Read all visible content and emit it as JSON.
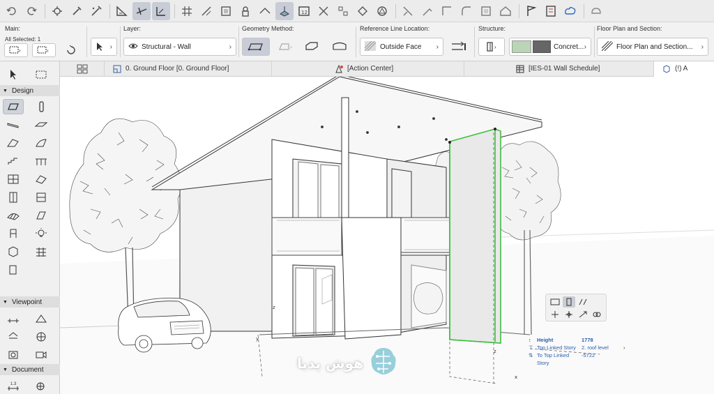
{
  "infobox": {
    "main_label": "Main:",
    "all_selected": "All Selected: 1",
    "layer_label": "Layer:",
    "layer_value": "Structural - Wall",
    "geometry_label": "Geometry Method:",
    "refline_label": "Reference Line Location:",
    "refline_value": "Outside Face",
    "structure_label": "Structure:",
    "structure_value": "Concret...",
    "floorplan_label": "Floor Plan and Section:",
    "floorplan_value": "Floor Plan and Section..."
  },
  "tabs": [
    {
      "label": "0. Ground Floor [0. Ground Floor]",
      "icon": "floor-plan-icon"
    },
    {
      "label": "[Action Center]",
      "icon": "action-center-icon"
    },
    {
      "label": "[IES-01 Wall Schedule]",
      "icon": "schedule-icon"
    },
    {
      "label": "(!) A",
      "icon": "3d-window-icon"
    }
  ],
  "toolbox": {
    "design": "Design",
    "viewpoint": "Viewpoint",
    "document": "Document"
  },
  "tracker": {
    "rows": [
      {
        "key": "Height",
        "value": "1778"
      },
      {
        "key": "Top Linked Story",
        "value": "2. roof level"
      },
      {
        "key": "To Top Linked Story",
        "value": "-5722"
      }
    ]
  },
  "watermark": {
    "text": "هوش پدیا"
  },
  "colors": {
    "selection": "#3fbf3f",
    "tracker_text": "#2a5db0",
    "watermark_icon": "#5fb7c9"
  }
}
